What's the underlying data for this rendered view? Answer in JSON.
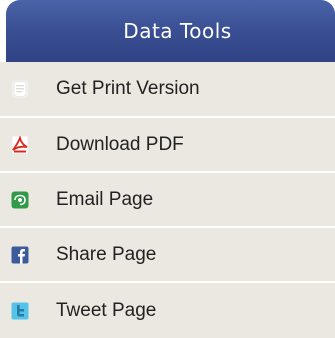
{
  "panel": {
    "title": "Data Tools",
    "header_color": "#3a4f93"
  },
  "items": [
    {
      "label": "Get Print Version",
      "icon": "print-page-icon"
    },
    {
      "label": "Download PDF",
      "icon": "pdf-icon"
    },
    {
      "label": "Email Page",
      "icon": "email-icon"
    },
    {
      "label": "Share Page",
      "icon": "facebook-icon"
    },
    {
      "label": "Tweet Page",
      "icon": "twitter-icon"
    }
  ]
}
